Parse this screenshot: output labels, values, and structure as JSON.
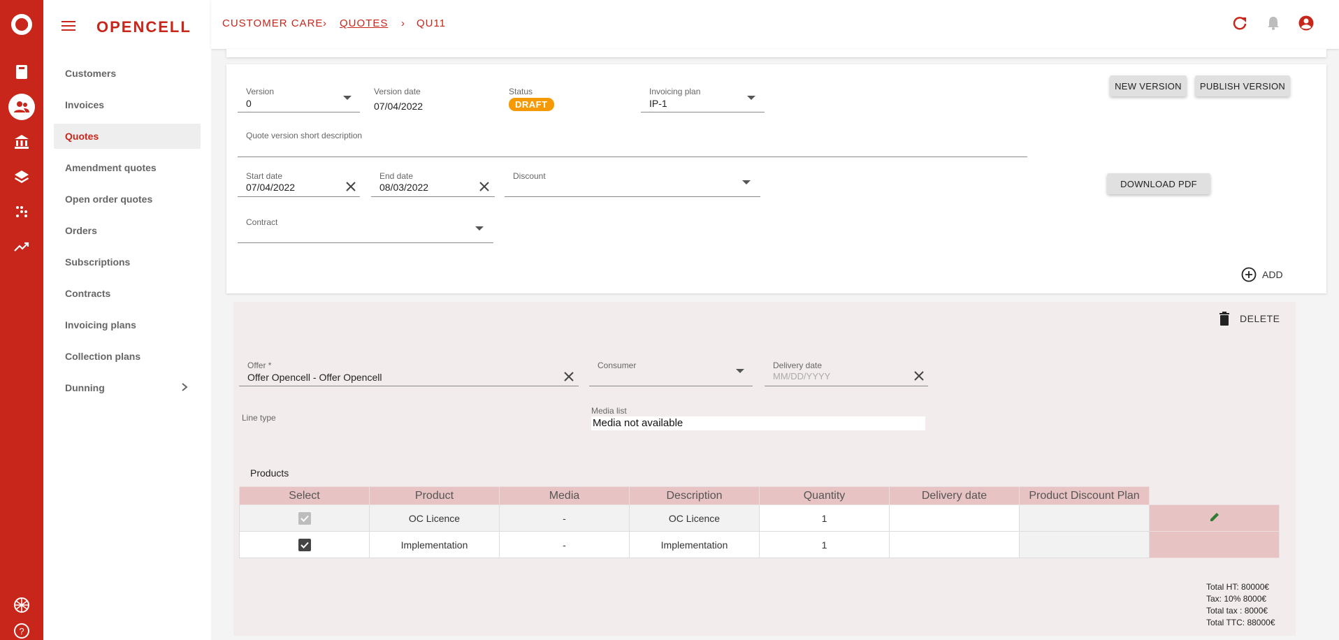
{
  "app": {
    "brand": "OPENCELL"
  },
  "breadcrumb": {
    "root": "CUSTOMER CARE",
    "section": "QUOTES",
    "current": "QU11"
  },
  "sidebar": {
    "items": [
      {
        "label": "Customers"
      },
      {
        "label": "Invoices"
      },
      {
        "label": "Quotes"
      },
      {
        "label": "Amendment quotes"
      },
      {
        "label": "Open order quotes"
      },
      {
        "label": "Orders"
      },
      {
        "label": "Subscriptions"
      },
      {
        "label": "Contracts"
      },
      {
        "label": "Invoicing plans"
      },
      {
        "label": "Collection plans"
      },
      {
        "label": "Dunning"
      }
    ],
    "active": "Quotes"
  },
  "quote": {
    "version_label": "Version",
    "version_value": "0",
    "version_date_label": "Version date",
    "version_date_value": "07/04/2022",
    "status_label": "Status",
    "status_value": "DRAFT",
    "invoicing_plan_label": "Invoicing plan",
    "invoicing_plan_value": "IP-1",
    "short_desc_label": "Quote version short description",
    "start_date_label": "Start date",
    "start_date_value": "07/04/2022",
    "end_date_label": "End date",
    "end_date_value": "08/03/2022",
    "discount_label": "Discount",
    "contract_label": "Contract",
    "new_version_btn": "NEW VERSION",
    "publish_version_btn": "PUBLISH VERSION",
    "download_pdf_btn": "DOWNLOAD PDF",
    "add_btn": "ADD"
  },
  "line": {
    "delete_btn": "DELETE",
    "offer_label": "Offer *",
    "offer_value": "Offer Opencell - Offer Opencell",
    "consumer_label": "Consumer",
    "delivery_date_label": "Delivery date",
    "delivery_date_placeholder": "MM/DD/YYYY",
    "line_type_label": "Line type",
    "media_list_label": "Media list",
    "media_list_value": "Media not available",
    "products_title": "Products"
  },
  "products_table": {
    "headers": [
      "Select",
      "Product",
      "Media",
      "Description",
      "Quantity",
      "Delivery date",
      "Product Discount Plan"
    ],
    "rows": [
      {
        "product": "OC Licence",
        "media": "-",
        "description": "OC Licence",
        "quantity": "1",
        "delivery_date": "",
        "discount_plan": "",
        "checked": true,
        "disabled": true
      },
      {
        "product": "Implementation",
        "media": "-",
        "description": "Implementation",
        "quantity": "1",
        "delivery_date": "",
        "discount_plan": "",
        "checked": true,
        "disabled": false
      }
    ]
  },
  "totals": {
    "ht": "Total HT: 80000€",
    "tax": "Tax: 10% 8000€",
    "total_tax": "Total tax : 8000€",
    "ttc": "Total TTC: 88000€"
  },
  "colors": {
    "brand": "#c8261a",
    "draft": "#f59a06",
    "table_header": "#e8c3c3"
  }
}
